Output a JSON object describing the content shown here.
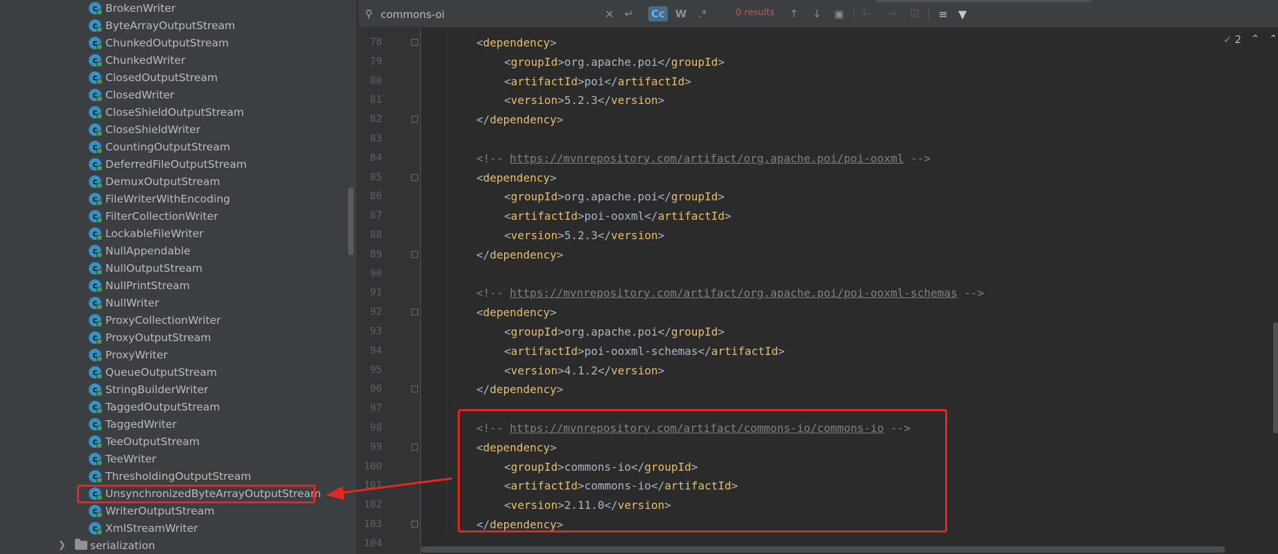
{
  "colors": {
    "annotation_red": "#e8251f",
    "xml_tag": "#e8bf6a",
    "xml_text": "#a9b7c6",
    "comment": "#808080",
    "class_icon": "#3592c4",
    "no_results": "#d25252"
  },
  "tree": {
    "items": [
      {
        "label": "BrokenWriter",
        "icon": "class-icon"
      },
      {
        "label": "ByteArrayOutputStream",
        "icon": "class-icon"
      },
      {
        "label": "ChunkedOutputStream",
        "icon": "class-icon"
      },
      {
        "label": "ChunkedWriter",
        "icon": "class-icon"
      },
      {
        "label": "ClosedOutputStream",
        "icon": "class-icon"
      },
      {
        "label": "ClosedWriter",
        "icon": "class-icon"
      },
      {
        "label": "CloseShieldOutputStream",
        "icon": "class-icon"
      },
      {
        "label": "CloseShieldWriter",
        "icon": "class-icon"
      },
      {
        "label": "CountingOutputStream",
        "icon": "class-icon"
      },
      {
        "label": "DeferredFileOutputStream",
        "icon": "class-icon"
      },
      {
        "label": "DemuxOutputStream",
        "icon": "class-icon"
      },
      {
        "label": "FileWriterWithEncoding",
        "icon": "class-icon"
      },
      {
        "label": "FilterCollectionWriter",
        "icon": "class-icon"
      },
      {
        "label": "LockableFileWriter",
        "icon": "class-icon"
      },
      {
        "label": "NullAppendable",
        "icon": "class-icon"
      },
      {
        "label": "NullOutputStream",
        "icon": "class-icon"
      },
      {
        "label": "NullPrintStream",
        "icon": "class-icon"
      },
      {
        "label": "NullWriter",
        "icon": "class-icon"
      },
      {
        "label": "ProxyCollectionWriter",
        "icon": "class-icon"
      },
      {
        "label": "ProxyOutputStream",
        "icon": "class-icon"
      },
      {
        "label": "ProxyWriter",
        "icon": "class-icon"
      },
      {
        "label": "QueueOutputStream",
        "icon": "class-icon"
      },
      {
        "label": "StringBuilderWriter",
        "icon": "class-icon"
      },
      {
        "label": "TaggedOutputStream",
        "icon": "class-icon"
      },
      {
        "label": "TaggedWriter",
        "icon": "class-icon"
      },
      {
        "label": "TeeOutputStream",
        "icon": "class-icon"
      },
      {
        "label": "TeeWriter",
        "icon": "class-icon"
      },
      {
        "label": "ThresholdingOutputStream",
        "icon": "class-icon"
      },
      {
        "label": "UnsynchronizedByteArrayOutputStream",
        "icon": "class-icon"
      },
      {
        "label": "WriterOutputStream",
        "icon": "class-icon"
      },
      {
        "label": "XmlStreamWriter",
        "icon": "class-icon"
      }
    ],
    "folder": {
      "label": "serialization",
      "icon": "folder-icon"
    }
  },
  "search": {
    "query": "commons-oi",
    "match_case_label": "Cc",
    "words_label": "W",
    "regex_label": ".*",
    "results_text": "0 results"
  },
  "inspection": {
    "count": "2"
  },
  "editor": {
    "lines": [
      {
        "n": "78",
        "tokens": [
          {
            "c": "br",
            "t": "<"
          },
          {
            "c": "tg",
            "t": "dependency"
          },
          {
            "c": "br",
            "t": ">"
          }
        ],
        "indent": 0,
        "fold": true
      },
      {
        "n": "79",
        "tokens": [
          {
            "c": "br",
            "t": "<"
          },
          {
            "c": "tg",
            "t": "groupId"
          },
          {
            "c": "br",
            "t": ">"
          },
          {
            "c": "tx",
            "t": "org.apache.poi"
          },
          {
            "c": "br",
            "t": "</"
          },
          {
            "c": "tg",
            "t": "groupId"
          },
          {
            "c": "br",
            "t": ">"
          }
        ],
        "indent": 1
      },
      {
        "n": "80",
        "tokens": [
          {
            "c": "br",
            "t": "<"
          },
          {
            "c": "tg",
            "t": "artifactId"
          },
          {
            "c": "br",
            "t": ">"
          },
          {
            "c": "tx",
            "t": "poi"
          },
          {
            "c": "br",
            "t": "</"
          },
          {
            "c": "tg",
            "t": "artifactId"
          },
          {
            "c": "br",
            "t": ">"
          }
        ],
        "indent": 1
      },
      {
        "n": "81",
        "tokens": [
          {
            "c": "br",
            "t": "<"
          },
          {
            "c": "tg",
            "t": "version"
          },
          {
            "c": "br",
            "t": ">"
          },
          {
            "c": "tx",
            "t": "5.2.3"
          },
          {
            "c": "br",
            "t": "</"
          },
          {
            "c": "tg",
            "t": "version"
          },
          {
            "c": "br",
            "t": ">"
          }
        ],
        "indent": 1
      },
      {
        "n": "82",
        "tokens": [
          {
            "c": "br",
            "t": "</"
          },
          {
            "c": "tg",
            "t": "dependency"
          },
          {
            "c": "br",
            "t": ">"
          }
        ],
        "indent": 0,
        "fold": true
      },
      {
        "n": "83",
        "tokens": [],
        "indent": 0
      },
      {
        "n": "84",
        "tokens": [
          {
            "c": "cm",
            "t": "<!-- "
          },
          {
            "c": "url",
            "t": "https://mvnrepository.com/artifact/org.apache.poi/poi-ooxml"
          },
          {
            "c": "cm",
            "t": " -->"
          }
        ],
        "indent": 0
      },
      {
        "n": "85",
        "tokens": [
          {
            "c": "br",
            "t": "<"
          },
          {
            "c": "tg",
            "t": "dependency"
          },
          {
            "c": "br",
            "t": ">"
          }
        ],
        "indent": 0,
        "fold": true
      },
      {
        "n": "86",
        "tokens": [
          {
            "c": "br",
            "t": "<"
          },
          {
            "c": "tg",
            "t": "groupId"
          },
          {
            "c": "br",
            "t": ">"
          },
          {
            "c": "tx",
            "t": "org.apache.poi"
          },
          {
            "c": "br",
            "t": "</"
          },
          {
            "c": "tg",
            "t": "groupId"
          },
          {
            "c": "br",
            "t": ">"
          }
        ],
        "indent": 1
      },
      {
        "n": "87",
        "tokens": [
          {
            "c": "br",
            "t": "<"
          },
          {
            "c": "tg",
            "t": "artifactId"
          },
          {
            "c": "br",
            "t": ">"
          },
          {
            "c": "tx",
            "t": "poi-ooxml"
          },
          {
            "c": "br",
            "t": "</"
          },
          {
            "c": "tg",
            "t": "artifactId"
          },
          {
            "c": "br",
            "t": ">"
          }
        ],
        "indent": 1
      },
      {
        "n": "88",
        "tokens": [
          {
            "c": "br",
            "t": "<"
          },
          {
            "c": "tg",
            "t": "version"
          },
          {
            "c": "br",
            "t": ">"
          },
          {
            "c": "tx",
            "t": "5.2.3"
          },
          {
            "c": "br",
            "t": "</"
          },
          {
            "c": "tg",
            "t": "version"
          },
          {
            "c": "br",
            "t": ">"
          }
        ],
        "indent": 1
      },
      {
        "n": "89",
        "tokens": [
          {
            "c": "br",
            "t": "</"
          },
          {
            "c": "tg",
            "t": "dependency"
          },
          {
            "c": "br",
            "t": ">"
          }
        ],
        "indent": 0,
        "fold": true
      },
      {
        "n": "90",
        "tokens": [],
        "indent": 0
      },
      {
        "n": "91",
        "tokens": [
          {
            "c": "cm",
            "t": "<!-- "
          },
          {
            "c": "url",
            "t": "https://mvnrepository.com/artifact/org.apache.poi/poi-ooxml-schemas"
          },
          {
            "c": "cm",
            "t": " -->"
          }
        ],
        "indent": 0
      },
      {
        "n": "92",
        "tokens": [
          {
            "c": "br",
            "t": "<"
          },
          {
            "c": "tg",
            "t": "dependency"
          },
          {
            "c": "br",
            "t": ">"
          }
        ],
        "indent": 0,
        "fold": true
      },
      {
        "n": "93",
        "tokens": [
          {
            "c": "br",
            "t": "<"
          },
          {
            "c": "tg",
            "t": "groupId"
          },
          {
            "c": "br",
            "t": ">"
          },
          {
            "c": "tx",
            "t": "org.apache.poi"
          },
          {
            "c": "br",
            "t": "</"
          },
          {
            "c": "tg",
            "t": "groupId"
          },
          {
            "c": "br",
            "t": ">"
          }
        ],
        "indent": 1
      },
      {
        "n": "94",
        "tokens": [
          {
            "c": "br",
            "t": "<"
          },
          {
            "c": "tg",
            "t": "artifactId"
          },
          {
            "c": "br",
            "t": ">"
          },
          {
            "c": "tx",
            "t": "poi-ooxml-schemas"
          },
          {
            "c": "br",
            "t": "</"
          },
          {
            "c": "tg",
            "t": "artifactId"
          },
          {
            "c": "br",
            "t": ">"
          }
        ],
        "indent": 1
      },
      {
        "n": "95",
        "tokens": [
          {
            "c": "br",
            "t": "<"
          },
          {
            "c": "tg",
            "t": "version"
          },
          {
            "c": "br",
            "t": ">"
          },
          {
            "c": "tx",
            "t": "4.1.2"
          },
          {
            "c": "br",
            "t": "</"
          },
          {
            "c": "tg",
            "t": "version"
          },
          {
            "c": "br",
            "t": ">"
          }
        ],
        "indent": 1
      },
      {
        "n": "96",
        "tokens": [
          {
            "c": "br",
            "t": "</"
          },
          {
            "c": "tg",
            "t": "dependency"
          },
          {
            "c": "br",
            "t": ">"
          }
        ],
        "indent": 0,
        "fold": true
      },
      {
        "n": "97",
        "tokens": [],
        "indent": 0
      },
      {
        "n": "98",
        "tokens": [
          {
            "c": "cm",
            "t": "<!-- "
          },
          {
            "c": "url",
            "t": "https://mvnrepository.com/artifact/commons-io/commons-io"
          },
          {
            "c": "cm",
            "t": " -->"
          }
        ],
        "indent": 0
      },
      {
        "n": "99",
        "tokens": [
          {
            "c": "br",
            "t": "<"
          },
          {
            "c": "tg",
            "t": "dependency"
          },
          {
            "c": "br",
            "t": ">"
          }
        ],
        "indent": 0,
        "fold": true
      },
      {
        "n": "100",
        "tokens": [
          {
            "c": "br",
            "t": "<"
          },
          {
            "c": "tg",
            "t": "groupId"
          },
          {
            "c": "br",
            "t": ">"
          },
          {
            "c": "tx",
            "t": "commons-io"
          },
          {
            "c": "br",
            "t": "</"
          },
          {
            "c": "tg",
            "t": "groupId"
          },
          {
            "c": "br",
            "t": ">"
          }
        ],
        "indent": 1
      },
      {
        "n": "101",
        "tokens": [
          {
            "c": "br",
            "t": "<"
          },
          {
            "c": "tg",
            "t": "artifactId"
          },
          {
            "c": "br",
            "t": ">"
          },
          {
            "c": "tx",
            "t": "commons-io"
          },
          {
            "c": "br",
            "t": "</"
          },
          {
            "c": "tg",
            "t": "artifactId"
          },
          {
            "c": "br",
            "t": ">"
          }
        ],
        "indent": 1
      },
      {
        "n": "102",
        "tokens": [
          {
            "c": "br",
            "t": "<"
          },
          {
            "c": "tg",
            "t": "version"
          },
          {
            "c": "br",
            "t": ">"
          },
          {
            "c": "tx",
            "t": "2.11.0"
          },
          {
            "c": "br",
            "t": "</"
          },
          {
            "c": "tg",
            "t": "version"
          },
          {
            "c": "br",
            "t": ">"
          }
        ],
        "indent": 1
      },
      {
        "n": "103",
        "tokens": [
          {
            "c": "br",
            "t": "</"
          },
          {
            "c": "tg",
            "t": "dependency"
          },
          {
            "c": "br",
            "t": ">"
          }
        ],
        "indent": 0,
        "fold": true
      },
      {
        "n": "104",
        "tokens": [],
        "indent": 0
      }
    ]
  }
}
